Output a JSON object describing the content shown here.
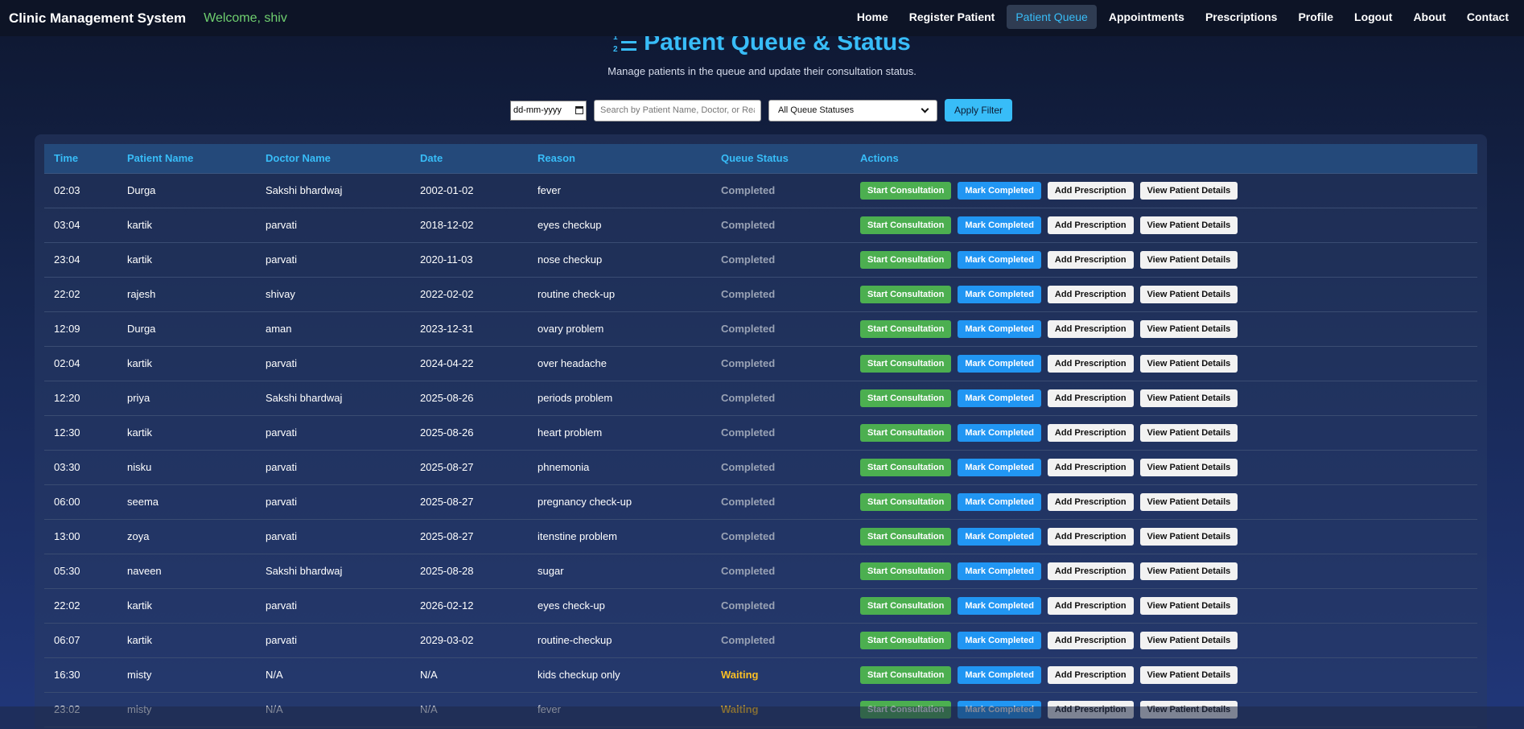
{
  "navbar": {
    "brand": "Clinic Management System",
    "welcome": "Welcome, shiv",
    "links": [
      "Home",
      "Register Patient",
      "Patient Queue",
      "Appointments",
      "Prescriptions",
      "Profile",
      "Logout",
      "About",
      "Contact"
    ],
    "active": "Patient Queue"
  },
  "header": {
    "title": "Patient Queue & Status",
    "subtitle": "Manage patients in the queue and update their consultation status."
  },
  "filters": {
    "date_placeholder": "dd-mm-yyyy",
    "search_placeholder": "Search by Patient Name, Doctor, or Reason",
    "status_selected": "All Queue Statuses",
    "apply_label": "Apply Filter"
  },
  "table": {
    "columns": [
      "Time",
      "Patient Name",
      "Doctor Name",
      "Date",
      "Reason",
      "Queue Status",
      "Actions"
    ],
    "action_labels": {
      "start": "Start Consultation",
      "complete": "Mark Completed",
      "prescription": "Add Prescription",
      "view": "View Patient Details"
    },
    "rows": [
      {
        "time": "02:03",
        "patient": "Durga",
        "doctor": "Sakshi bhardwaj",
        "date": "2002-01-02",
        "reason": "fever",
        "status": "Completed"
      },
      {
        "time": "03:04",
        "patient": "kartik",
        "doctor": "parvati",
        "date": "2018-12-02",
        "reason": "eyes checkup",
        "status": "Completed"
      },
      {
        "time": "23:04",
        "patient": "kartik",
        "doctor": "parvati",
        "date": "2020-11-03",
        "reason": "nose checkup",
        "status": "Completed"
      },
      {
        "time": "22:02",
        "patient": "rajesh",
        "doctor": "shivay",
        "date": "2022-02-02",
        "reason": "routine check-up",
        "status": "Completed"
      },
      {
        "time": "12:09",
        "patient": "Durga",
        "doctor": "aman",
        "date": "2023-12-31",
        "reason": "ovary problem",
        "status": "Completed"
      },
      {
        "time": "02:04",
        "patient": "kartik",
        "doctor": "parvati",
        "date": "2024-04-22",
        "reason": "over headache",
        "status": "Completed"
      },
      {
        "time": "12:20",
        "patient": "priya",
        "doctor": "Sakshi bhardwaj",
        "date": "2025-08-26",
        "reason": "periods problem",
        "status": "Completed"
      },
      {
        "time": "12:30",
        "patient": "kartik",
        "doctor": "parvati",
        "date": "2025-08-26",
        "reason": "heart problem",
        "status": "Completed"
      },
      {
        "time": "03:30",
        "patient": "nisku",
        "doctor": "parvati",
        "date": "2025-08-27",
        "reason": "phnemonia",
        "status": "Completed"
      },
      {
        "time": "06:00",
        "patient": "seema",
        "doctor": "parvati",
        "date": "2025-08-27",
        "reason": "pregnancy check-up",
        "status": "Completed"
      },
      {
        "time": "13:00",
        "patient": "zoya",
        "doctor": "parvati",
        "date": "2025-08-27",
        "reason": "itenstine problem",
        "status": "Completed"
      },
      {
        "time": "05:30",
        "patient": "naveen",
        "doctor": "Sakshi bhardwaj",
        "date": "2025-08-28",
        "reason": "sugar",
        "status": "Completed"
      },
      {
        "time": "22:02",
        "patient": "kartik",
        "doctor": "parvati",
        "date": "2026-02-12",
        "reason": "eyes check-up",
        "status": "Completed"
      },
      {
        "time": "06:07",
        "patient": "kartik",
        "doctor": "parvati",
        "date": "2029-03-02",
        "reason": "routine-checkup",
        "status": "Completed"
      },
      {
        "time": "16:30",
        "patient": "misty",
        "doctor": "N/A",
        "date": "N/A",
        "reason": "kids checkup only",
        "status": "Waiting"
      },
      {
        "time": "23:02",
        "patient": "misty",
        "doctor": "N/A",
        "date": "N/A",
        "reason": "fever",
        "status": "Waiting"
      }
    ]
  },
  "colors": {
    "accent": "#38bdf8",
    "start": "#4caf50",
    "complete": "#2196f3",
    "waiting": "#fbbf24",
    "completed": "#9aa3b5",
    "welcome": "#6fcf6f"
  }
}
